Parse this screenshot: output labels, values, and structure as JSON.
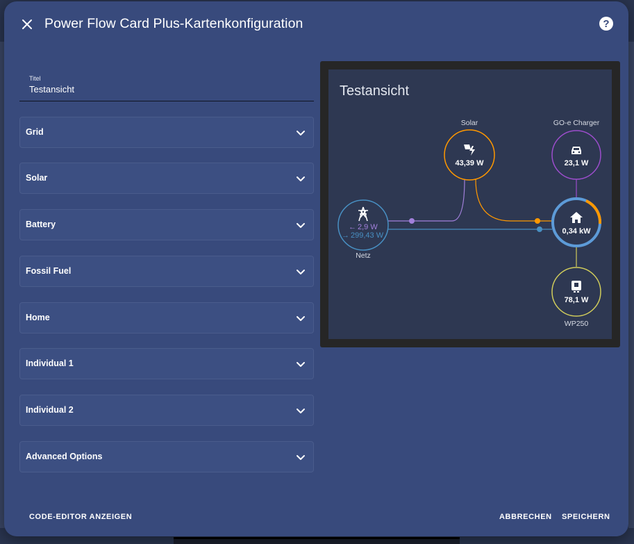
{
  "dialog": {
    "title": "Power Flow Card Plus-Kartenkonfiguration"
  },
  "title_field": {
    "label": "Titel",
    "value": "Testansicht"
  },
  "sections": [
    {
      "label": "Grid"
    },
    {
      "label": "Solar"
    },
    {
      "label": "Battery"
    },
    {
      "label": "Fossil Fuel"
    },
    {
      "label": "Home"
    },
    {
      "label": "Individual 1"
    },
    {
      "label": "Individual 2"
    },
    {
      "label": "Advanced Options"
    }
  ],
  "footer": {
    "code_editor": "CODE-EDITOR ANZEIGEN",
    "cancel": "ABBRECHEN",
    "save": "SPEICHERN"
  },
  "preview": {
    "card_title": "Testansicht",
    "solar": {
      "label": "Solar",
      "value": "43,39 W",
      "color": "#ff9800"
    },
    "charger": {
      "label": "GO-e Charger",
      "value": "23,1 W",
      "color": "#9c4dcc"
    },
    "grid": {
      "label": "Netz",
      "export": "2,9 W",
      "import": "299,43 W",
      "color": "#488fc2",
      "export_color": "#a280db"
    },
    "home": {
      "value": "0,34 kW",
      "color": "#5d9bd8"
    },
    "heatpump": {
      "label": "WP250",
      "value": "78,1 W",
      "color": "#d0cc5b"
    }
  },
  "colors": {
    "dialog_bg": "#384a7c",
    "expander_bg": "#3c4f82",
    "preview_bg": "#2e3852"
  }
}
